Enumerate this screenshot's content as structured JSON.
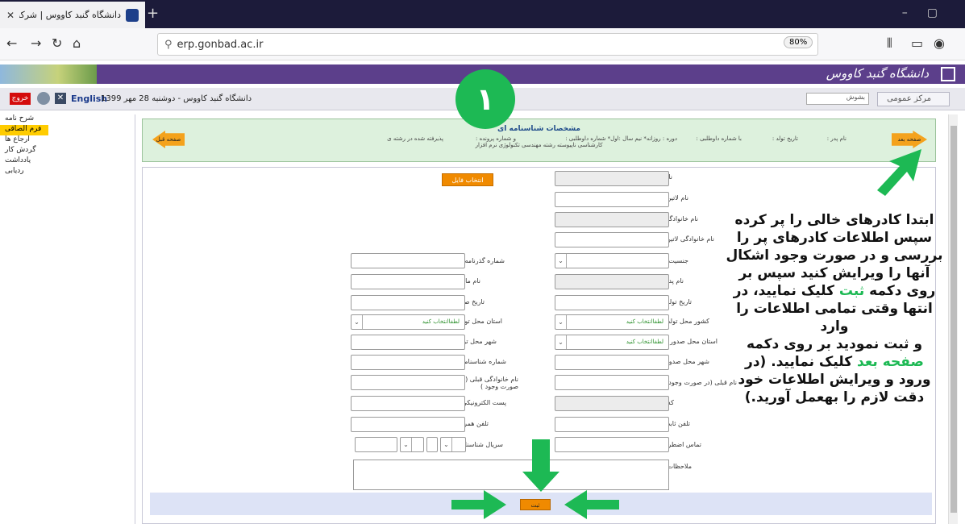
{
  "browser": {
    "tab_title": "دانشگاه گنبد کاووس | شرکت سا...",
    "url": "erp.gonbad.ac.ir",
    "zoom": "80%"
  },
  "site": {
    "logo_text": "دانشگاه گنبد کاووس"
  },
  "infobar": {
    "exit": "خروج",
    "english": "English",
    "date": "دانشگاه گنبد کاووس - دوشنبه 28 مهر 1399",
    "search_placeholder": "بشوش",
    "public_center": "مرکز عمومی"
  },
  "sidebar": {
    "items": [
      {
        "label": "شرح نامه"
      },
      {
        "label": "فرم الصاقی"
      },
      {
        "label": "ارجاع ها"
      },
      {
        "label": "گردش کار"
      },
      {
        "label": "یادداشت"
      },
      {
        "label": "ردیابی"
      }
    ]
  },
  "summary": {
    "title": "مشخصات شناسنامه ای",
    "name_label": "نام پدر :",
    "birth_label": "تاریخ تولد :",
    "applicant_label": "با شماره داوطلبی :",
    "course_label": "دوره : روزانه* نیم سال :اول* شماره داوطلبی :",
    "file_label": "و شماره پرونده :",
    "accepted_label": "پذیرفته شده در رشته ی",
    "line2": "کارشناسی ناپیوسته رشته مهندسی تکنولوژی نرم افزار",
    "next": "صفحه بعد",
    "prev": "صفحه قبل"
  },
  "form": {
    "file_button": "انتخاب فایل",
    "right_labels": [
      "نام :",
      "نام لاتین :",
      "نام خانوادگی :",
      "نام خانوادگی لاتین :",
      "جنسیت :",
      "نام پدر :",
      "تاریخ تولد :",
      "کشور محل تولد :",
      "استان محل صدور :",
      "شهر محل صدور:",
      "نام قبلی (در صورت وجود ) :",
      "کد ملی:",
      "تلفن ثابت :",
      "تماس اضطراری :",
      "ملاحظات :"
    ],
    "left_labels": [
      "شماره گذرنامه :",
      "نام مادر :",
      "تاریخ صدور :",
      "استان محل تولد:",
      "شهر محل تولد:",
      "شماره شناسنامه:",
      "نام خانوادگی قبلی (در صورت وجود )",
      "پست الکترونیکی:",
      "تلفن همراه :",
      "سریال شناسنامه:"
    ],
    "select_placeholder": "لطفاانتخاب کنید",
    "submit": "ثبت"
  },
  "annotation": {
    "step_number": "١",
    "line1": "ابتدا کادرهای خالی را پر کرده",
    "line2": "سپس اطلاعات کادرهای پر را",
    "line3": "بررسی و در صورت وجود اشکال",
    "line4": "آنها را ویرایش کنید سپس بر",
    "line5_pre": "روی دکمه ",
    "line5_green": "ثبت",
    "line5_post": " کلیک نمایید، در",
    "line6": "انتها وقتی تمامی اطلاعات را وارد",
    "line7": "و ثبت نمودید بر روی دکمه",
    "line8_green": "صفحه بعد",
    "line8_post": " کلیک نمایید. (در",
    "line9": "ورود و ویرایش اطلاعات خود",
    "line10": "دقت لازم را بهعمل آورید.)",
    "color": "#1db954"
  }
}
